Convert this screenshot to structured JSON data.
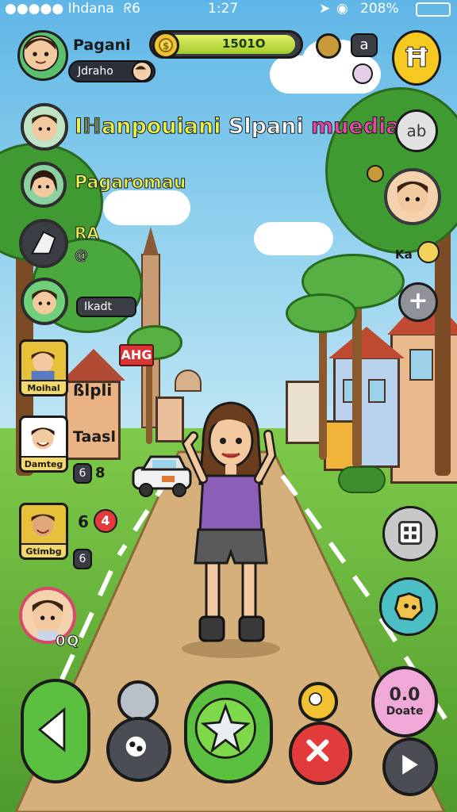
{
  "status_bar": {
    "carrier": "●●●●● Ihdana",
    "network": "ᖇ6",
    "time": "1:27",
    "battery_percent": "208%"
  },
  "profile": {
    "name": "Pagani",
    "sub_label": "Jdraho",
    "avatar_icon": "player-avatar"
  },
  "currency": {
    "value": "1501O",
    "fill_fraction": 0.98,
    "icon": "coin-icon"
  },
  "top_right": {
    "level_label": "Ħ",
    "menu_glyph": "a",
    "chat_glyph": "ab"
  },
  "banner": {
    "part1": "Iℍanpouiani",
    "part2": "Slpani",
    "part3": "muedian"
  },
  "subtitle": "Pagaromau",
  "friends": [
    {
      "tag": "RA",
      "sub": "@"
    },
    {
      "tag": "Ikadt",
      "sub": ""
    },
    {
      "tag": "ßlpli",
      "frame_caption": "Moihal"
    },
    {
      "tag": "Taasl",
      "frame_caption": "Damteg",
      "chip": "6",
      "extra": "8"
    },
    {
      "tag": "6",
      "frame_caption": "Gtimbg",
      "badge": "4",
      "chip": "6"
    },
    {
      "tag": "0",
      "extra": "Q"
    }
  ],
  "sign_text": "AHG",
  "right_panel": {
    "small_label": "Ka",
    "plus_glyph": "+",
    "pink_button_line1": "0.0",
    "pink_button_line2": "Doate"
  },
  "colors": {
    "banner_yellow": "#e9f14a",
    "banner_pink": "#e04aa6",
    "green_button": "#5bc040",
    "red_button": "#e23b3b",
    "pink_button": "#f0a8d8"
  }
}
